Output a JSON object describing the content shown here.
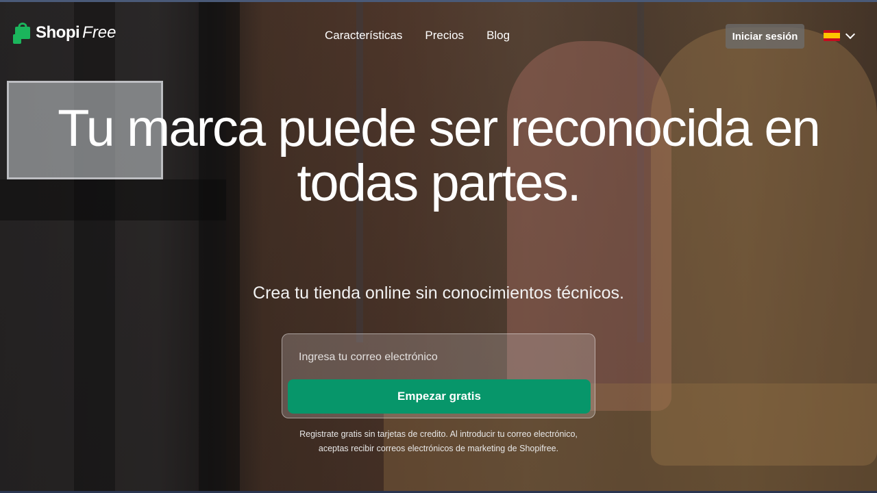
{
  "brand": {
    "name_bold": "Shopi",
    "name_italic": "Free",
    "logo_icon": "shopping-bag-icon",
    "accent": "#1bb55c"
  },
  "nav": {
    "items": [
      {
        "label": "Características"
      },
      {
        "label": "Precios"
      },
      {
        "label": "Blog"
      }
    ]
  },
  "header": {
    "login_label": "Iniciar sesión",
    "language_flag": "spain-flag-icon",
    "chevron": "chevron-down-icon"
  },
  "hero": {
    "headline": "Tu marca puede ser reconocida en todas partes.",
    "subheadline": "Crea tu tienda online sin conocimientos técnicos.",
    "email_placeholder": "Ingresa tu correo electrónico",
    "cta_label": "Empezar gratis",
    "cta_color": "#07966a",
    "disclaimer_line1": "Registrate gratis sin tarjetas de credito. Al introducir tu correo electrónico,",
    "disclaimer_line2": "aceptas recibir correos electrónicos de marketing de Shopifree."
  }
}
